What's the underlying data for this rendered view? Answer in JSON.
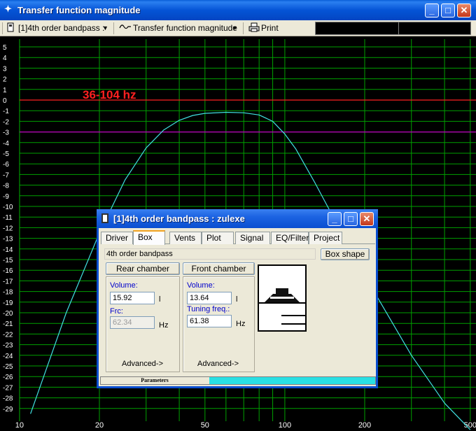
{
  "window": {
    "title": "Transfer function magnitude",
    "minimize": "_",
    "maximize": "□",
    "close": "✕"
  },
  "toolbar": {
    "project_dropdown": "[1]4th order bandpass :",
    "view_dropdown": "Transfer function magnitude",
    "print_label": "Print"
  },
  "plot": {
    "annotation": "36-104 hz",
    "y_ticks": [
      "5",
      "4",
      "3",
      "2",
      "1",
      "0",
      "-1",
      "-2",
      "-3",
      "-4",
      "-5",
      "-6",
      "-7",
      "-8",
      "-9",
      "-10",
      "-11",
      "-12",
      "-13",
      "-14",
      "-15",
      "-16",
      "-17",
      "-18",
      "-19",
      "-20",
      "-21",
      "-22",
      "-23",
      "-24",
      "-25",
      "-26",
      "-27",
      "-28",
      "-29"
    ],
    "x_ticks": [
      "10",
      "20",
      "50",
      "100",
      "200",
      "500"
    ],
    "colors": {
      "grid": "#00a000",
      "curve": "#40e0e0",
      "zero_line": "#ff2020",
      "minus3_line": "#c000c0",
      "annotation": "#ff2020"
    }
  },
  "chart_data": {
    "type": "line",
    "xscale": "log",
    "xlim": [
      9,
      520
    ],
    "ylim": [
      -30,
      5.5
    ],
    "ylabel": "",
    "xlabel": "",
    "reference_lines": [
      0,
      -3
    ],
    "series": [
      {
        "x": [
          11,
          15,
          20,
          25,
          30,
          35,
          40,
          45,
          50,
          60,
          70,
          80,
          90,
          100,
          110,
          130,
          150,
          200,
          300,
          400,
          500
        ],
        "y": [
          -29.5,
          -20,
          -12.5,
          -7.5,
          -4.5,
          -2.8,
          -1.9,
          -1.45,
          -1.25,
          -1.15,
          -1.2,
          -1.4,
          -2.0,
          -3.2,
          -4.6,
          -7.8,
          -10.7,
          -16.5,
          -24,
          -28.5,
          -31
        ]
      }
    ]
  },
  "dialog": {
    "title": "[1]4th order bandpass : zulexe",
    "tabs": [
      "Driver",
      "Box",
      "Vents",
      "Plot",
      "Signal",
      "EQ/Filter",
      "Project"
    ],
    "active_tab": "Box",
    "box_type": "4th order bandpass",
    "box_shape_button": "Box shape",
    "rear": {
      "header": "Rear chamber",
      "volume_label": "Volume:",
      "volume_value": "15.92",
      "volume_unit": "l",
      "frc_label": "Frc:",
      "frc_value": "62.34",
      "frc_unit": "Hz",
      "advanced": "Advanced->"
    },
    "front": {
      "header": "Front chamber",
      "volume_label": "Volume:",
      "volume_value": "13.64",
      "volume_unit": "l",
      "tuning_label": "Tuning freq.:",
      "tuning_value": "61.38",
      "tuning_unit": "Hz",
      "advanced": "Advanced->"
    },
    "status_label": "Parameters"
  }
}
